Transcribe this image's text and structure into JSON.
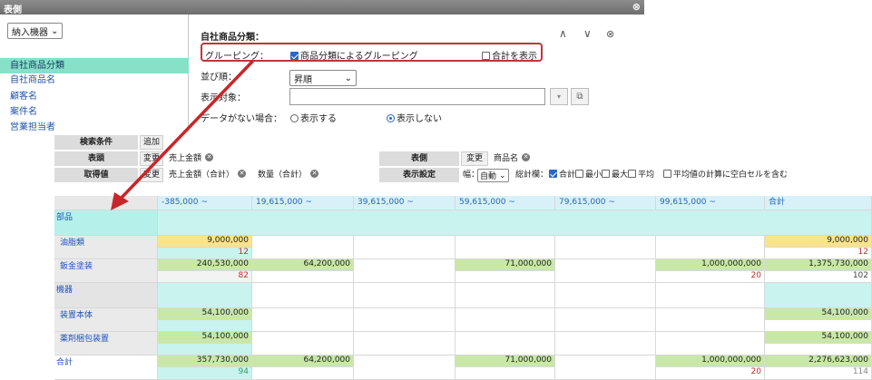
{
  "window": {
    "title": "表側"
  },
  "left": {
    "dropdown": "納入機器",
    "items": [
      "自社商品分類",
      "自社商品名",
      "顧客名",
      "案件名",
      "営業担当者"
    ]
  },
  "settings": {
    "section_title": "自社商品分類：",
    "grouping_label": "グルーピング：",
    "grouping_check": "商品分類によるグルーピング",
    "show_total": "合計を表示",
    "sort_label": "並び順：",
    "sort_value": "昇順",
    "target_label": "表示対象：",
    "nodata_label": "データがない場合：",
    "nodata_show": "表示する",
    "nodata_hide": "表示しない"
  },
  "band": {
    "cond_label": "検索条件",
    "cond_add": "追加",
    "head_label": "表頭",
    "head_change": "変更",
    "head_value": "売上金額",
    "val_label": "取得値",
    "val_change": "変更",
    "val_1": "売上金額（合計）",
    "val_2": "数量（合計）",
    "side_label": "表側",
    "side_change": "変更",
    "side_value": "商品名",
    "disp_label": "表示設定",
    "width_label": "幅：",
    "width_value": "自動",
    "totals_label": "総計欄：",
    "opt_sum": "合計",
    "opt_min": "最小",
    "opt_max": "最大",
    "opt_avg": "平均",
    "opt_blank": "平均値の計算に空白セルを含む"
  },
  "grid": {
    "columns": [
      "-385,000 ~",
      "19,615,000 ~",
      "39,615,000 ~",
      "59,615,000 ~",
      "79,615,000 ~",
      "99,615,000 ~",
      "合計"
    ],
    "groups": {
      "g1": "部品",
      "g2": "機器"
    },
    "rows": {
      "r1": {
        "name": "油脂類",
        "a": "9,000,000",
        "a_cnt": "12",
        "total": "9,000,000",
        "total_cnt": "12"
      },
      "r2": {
        "name": "鈑金塗装",
        "a": "240,530,000",
        "a_cnt": "82",
        "b": "64,200,000",
        "d": "71,000,000",
        "f": "1,000,000,000",
        "f_cnt": "20",
        "total": "1,375,730,000",
        "total_cnt": "102"
      },
      "r3": {
        "name": "装置本体",
        "a": "54,100,000",
        "total": "54,100,000"
      },
      "r4": {
        "name": "薬剤梱包装置",
        "a": "54,100,000",
        "total": "54,100,000"
      },
      "sum": {
        "name": "合計",
        "a": "357,730,000",
        "a_cnt": "94",
        "b": "64,200,000",
        "d": "71,000,000",
        "f": "1,000,000,000",
        "f_cnt": "20",
        "total": "2,276,623,000",
        "total_cnt": "114"
      }
    }
  }
}
